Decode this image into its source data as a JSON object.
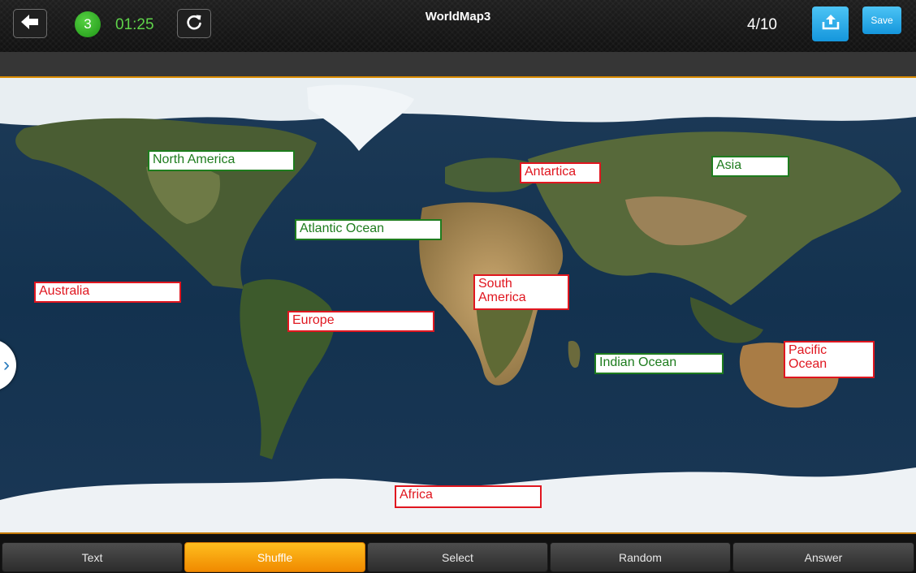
{
  "header": {
    "title": "WorldMap3",
    "level": "3",
    "timer": "01:25",
    "progress": "4/10",
    "save_label": "Save"
  },
  "icons": {
    "back": "arrow-left-icon",
    "reload": "reload-icon",
    "upload": "upload-icon",
    "side_toggle": "chevron-right-icon"
  },
  "colors": {
    "correct": "#1e7c1e",
    "incorrect": "#e0161f",
    "accent": "#f7a20a",
    "save": "#22a8ea",
    "level_badge": "#3db52a"
  },
  "labels": [
    {
      "text": "North America",
      "status": "correct"
    },
    {
      "text": "Antartica",
      "status": "incorrect"
    },
    {
      "text": "Asia",
      "status": "correct"
    },
    {
      "text": "Atlantic Ocean",
      "status": "correct"
    },
    {
      "text": "Australia",
      "status": "incorrect"
    },
    {
      "text": "South\nAmerica",
      "status": "incorrect"
    },
    {
      "text": "Europe",
      "status": "incorrect"
    },
    {
      "text": "Indian Ocean",
      "status": "correct"
    },
    {
      "text": "Pacific\nOcean",
      "status": "incorrect"
    },
    {
      "text": "Africa",
      "status": "incorrect"
    }
  ],
  "toolbar": {
    "buttons": [
      "Text",
      "Shuffle",
      "Select",
      "Random",
      "Answer"
    ],
    "active": "Shuffle"
  }
}
